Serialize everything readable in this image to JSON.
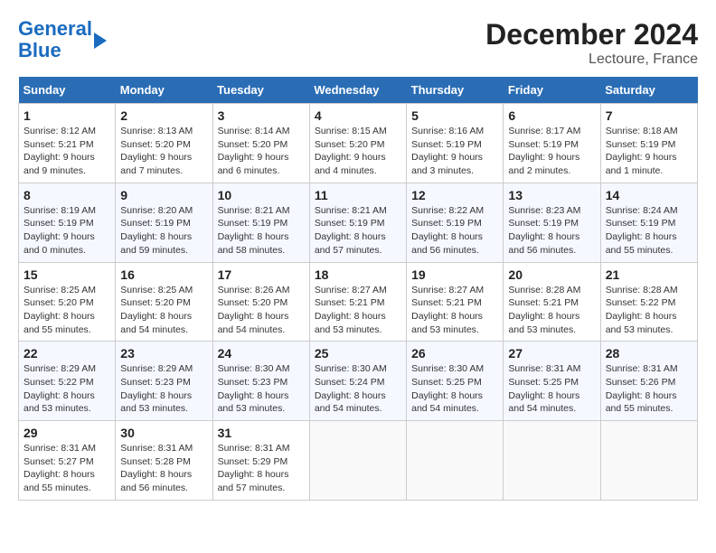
{
  "header": {
    "logo_line1": "General",
    "logo_line2": "Blue",
    "title": "December 2024",
    "subtitle": "Lectoure, France"
  },
  "calendar": {
    "weekdays": [
      "Sunday",
      "Monday",
      "Tuesday",
      "Wednesday",
      "Thursday",
      "Friday",
      "Saturday"
    ],
    "weeks": [
      [
        {
          "day": "1",
          "info": "Sunrise: 8:12 AM\nSunset: 5:21 PM\nDaylight: 9 hours and 9 minutes."
        },
        {
          "day": "2",
          "info": "Sunrise: 8:13 AM\nSunset: 5:20 PM\nDaylight: 9 hours and 7 minutes."
        },
        {
          "day": "3",
          "info": "Sunrise: 8:14 AM\nSunset: 5:20 PM\nDaylight: 9 hours and 6 minutes."
        },
        {
          "day": "4",
          "info": "Sunrise: 8:15 AM\nSunset: 5:20 PM\nDaylight: 9 hours and 4 minutes."
        },
        {
          "day": "5",
          "info": "Sunrise: 8:16 AM\nSunset: 5:19 PM\nDaylight: 9 hours and 3 minutes."
        },
        {
          "day": "6",
          "info": "Sunrise: 8:17 AM\nSunset: 5:19 PM\nDaylight: 9 hours and 2 minutes."
        },
        {
          "day": "7",
          "info": "Sunrise: 8:18 AM\nSunset: 5:19 PM\nDaylight: 9 hours and 1 minute."
        }
      ],
      [
        {
          "day": "8",
          "info": "Sunrise: 8:19 AM\nSunset: 5:19 PM\nDaylight: 9 hours and 0 minutes."
        },
        {
          "day": "9",
          "info": "Sunrise: 8:20 AM\nSunset: 5:19 PM\nDaylight: 8 hours and 59 minutes."
        },
        {
          "day": "10",
          "info": "Sunrise: 8:21 AM\nSunset: 5:19 PM\nDaylight: 8 hours and 58 minutes."
        },
        {
          "day": "11",
          "info": "Sunrise: 8:21 AM\nSunset: 5:19 PM\nDaylight: 8 hours and 57 minutes."
        },
        {
          "day": "12",
          "info": "Sunrise: 8:22 AM\nSunset: 5:19 PM\nDaylight: 8 hours and 56 minutes."
        },
        {
          "day": "13",
          "info": "Sunrise: 8:23 AM\nSunset: 5:19 PM\nDaylight: 8 hours and 56 minutes."
        },
        {
          "day": "14",
          "info": "Sunrise: 8:24 AM\nSunset: 5:19 PM\nDaylight: 8 hours and 55 minutes."
        }
      ],
      [
        {
          "day": "15",
          "info": "Sunrise: 8:25 AM\nSunset: 5:20 PM\nDaylight: 8 hours and 55 minutes."
        },
        {
          "day": "16",
          "info": "Sunrise: 8:25 AM\nSunset: 5:20 PM\nDaylight: 8 hours and 54 minutes."
        },
        {
          "day": "17",
          "info": "Sunrise: 8:26 AM\nSunset: 5:20 PM\nDaylight: 8 hours and 54 minutes."
        },
        {
          "day": "18",
          "info": "Sunrise: 8:27 AM\nSunset: 5:21 PM\nDaylight: 8 hours and 53 minutes."
        },
        {
          "day": "19",
          "info": "Sunrise: 8:27 AM\nSunset: 5:21 PM\nDaylight: 8 hours and 53 minutes."
        },
        {
          "day": "20",
          "info": "Sunrise: 8:28 AM\nSunset: 5:21 PM\nDaylight: 8 hours and 53 minutes."
        },
        {
          "day": "21",
          "info": "Sunrise: 8:28 AM\nSunset: 5:22 PM\nDaylight: 8 hours and 53 minutes."
        }
      ],
      [
        {
          "day": "22",
          "info": "Sunrise: 8:29 AM\nSunset: 5:22 PM\nDaylight: 8 hours and 53 minutes."
        },
        {
          "day": "23",
          "info": "Sunrise: 8:29 AM\nSunset: 5:23 PM\nDaylight: 8 hours and 53 minutes."
        },
        {
          "day": "24",
          "info": "Sunrise: 8:30 AM\nSunset: 5:23 PM\nDaylight: 8 hours and 53 minutes."
        },
        {
          "day": "25",
          "info": "Sunrise: 8:30 AM\nSunset: 5:24 PM\nDaylight: 8 hours and 54 minutes."
        },
        {
          "day": "26",
          "info": "Sunrise: 8:30 AM\nSunset: 5:25 PM\nDaylight: 8 hours and 54 minutes."
        },
        {
          "day": "27",
          "info": "Sunrise: 8:31 AM\nSunset: 5:25 PM\nDaylight: 8 hours and 54 minutes."
        },
        {
          "day": "28",
          "info": "Sunrise: 8:31 AM\nSunset: 5:26 PM\nDaylight: 8 hours and 55 minutes."
        }
      ],
      [
        {
          "day": "29",
          "info": "Sunrise: 8:31 AM\nSunset: 5:27 PM\nDaylight: 8 hours and 55 minutes."
        },
        {
          "day": "30",
          "info": "Sunrise: 8:31 AM\nSunset: 5:28 PM\nDaylight: 8 hours and 56 minutes."
        },
        {
          "day": "31",
          "info": "Sunrise: 8:31 AM\nSunset: 5:29 PM\nDaylight: 8 hours and 57 minutes."
        },
        {
          "day": "",
          "info": ""
        },
        {
          "day": "",
          "info": ""
        },
        {
          "day": "",
          "info": ""
        },
        {
          "day": "",
          "info": ""
        }
      ]
    ]
  }
}
